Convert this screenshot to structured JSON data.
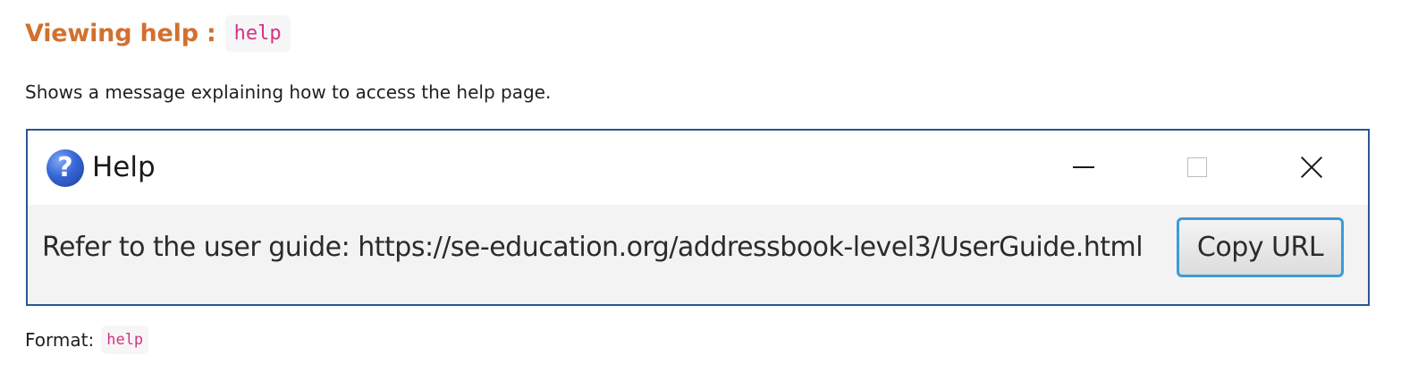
{
  "section": {
    "heading": "Viewing help :",
    "command": "help",
    "description": "Shows a message explaining how to access the help page."
  },
  "window": {
    "title": "Help",
    "icon": "help-question-icon",
    "controls": {
      "minimize": "minimize-icon",
      "maximize": "maximize-icon",
      "close": "close-icon"
    },
    "message": "Refer to the user guide: https://se-education.org/addressbook-level3/UserGuide.html",
    "copy_button_label": "Copy URL"
  },
  "format": {
    "label": "Format:",
    "command": "help"
  },
  "colors": {
    "heading": "#d2702e",
    "code": "#d63384",
    "window_border": "#2a568f",
    "button_focus": "#3e9bd6"
  }
}
